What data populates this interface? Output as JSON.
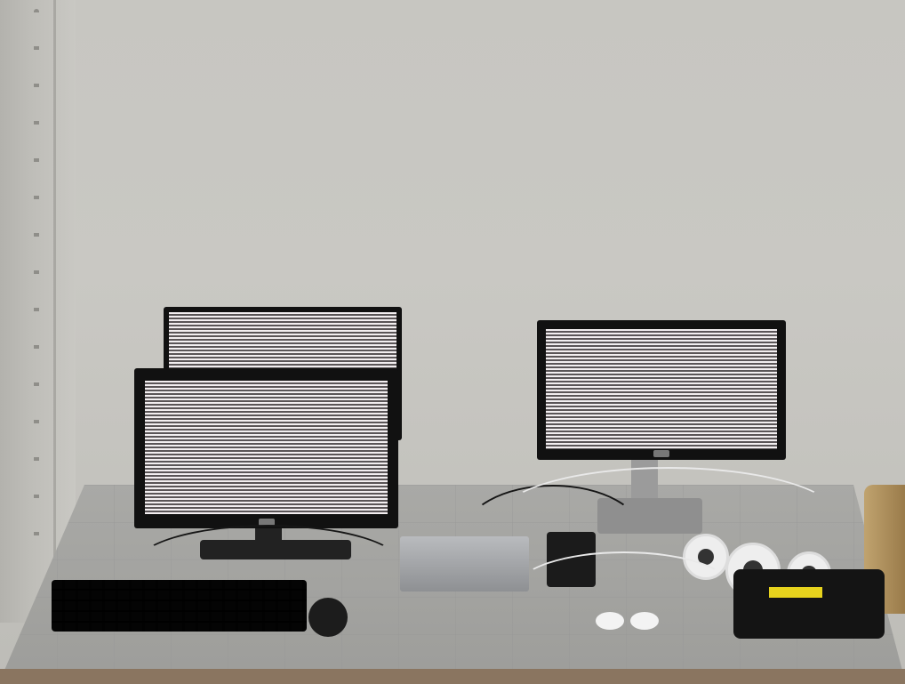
{
  "scene": {
    "objects": [
      {
        "name": "rear-monitor"
      },
      {
        "name": "left-monitor",
        "brand": "DELL"
      },
      {
        "name": "right-monitor",
        "brand": "DELL"
      },
      {
        "name": "keyboard"
      },
      {
        "name": "mouse"
      },
      {
        "name": "control-box"
      },
      {
        "name": "power-adapter"
      },
      {
        "name": "cameras"
      },
      {
        "name": "handheld-device"
      }
    ]
  },
  "colors": {
    "wall": "#c7c6c1",
    "table": "#a9a9a6",
    "monitor_bezel": "#111111",
    "screen_light": "#f2eef0",
    "screen_dark": "#5a5557",
    "device_label": "#e7d31d"
  }
}
